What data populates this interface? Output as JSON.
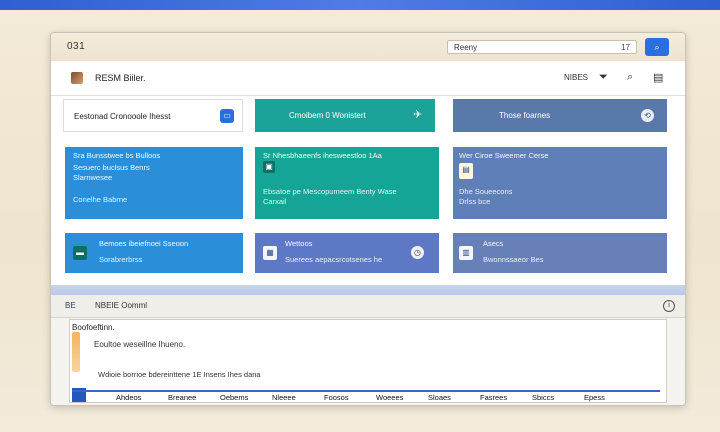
{
  "window": {
    "title": "031"
  },
  "search": {
    "value": "Reeny",
    "filter_label": "17",
    "button_icon": "search-icon"
  },
  "header": {
    "app_name": "RESM Biiler.",
    "user_label": "NIBES",
    "icons": [
      "filter-icon",
      "search-icon",
      "grid-icon"
    ]
  },
  "tiles_top": [
    {
      "label": "Eestonad Cronooole Ihesst",
      "color": "#ffffff"
    },
    {
      "label": "Cmoibem 0 Wonistert",
      "color": "#1ba39a"
    },
    {
      "label": "Those foarnes",
      "color": "#5a79ab"
    }
  ],
  "tiles_mid": [
    {
      "lines": [
        "Sra Bunsstwee bs Bulloos",
        "Sesuerc buclsus Benrs",
        "Slarnwesee"
      ],
      "sub": "Conelhe Babrne",
      "color": "#2a8fd8"
    },
    {
      "lines": [
        "Sr Nhesbhaeenfs ihesweestloo 1Aa"
      ],
      "sub": "Ebsatoe pe Mescopumeem Benty Wase",
      "sub2": "Carxail",
      "color": "#15a596"
    },
    {
      "lines": [
        "Wer Ciroe Sweemer Cerse"
      ],
      "sub": "Dhe Soueecons",
      "sub2": "Drlss bce",
      "color": "#5e7fb7"
    }
  ],
  "tiles_low": [
    {
      "title": "Bemoes ibeiefnoei Sseoon",
      "sub": "Sorabrerbrss",
      "color": "#2a8fd8"
    },
    {
      "title": "Wettoos",
      "sub": "Suerees aepacsrcotsenes he",
      "color": "#5d79c6"
    },
    {
      "title": "Asecs",
      "sub": "Bwonnssaeor Bes",
      "color": "#6780b8"
    }
  ],
  "bottom": {
    "tag": "BE",
    "label": "NBEIE Oomml",
    "line1": "Boofoeftinn.",
    "line2": "Eoultoe weseillne Ihueno.",
    "line3": "Wdioie borrioe bdereinttene 1E Insens Ihes dana",
    "columns": [
      "Ahdeos",
      "Breanee",
      "Oebems",
      "Nleeee",
      "Foosos",
      "Woeees",
      "Sloaes",
      "Fasrees",
      "Sbiccs",
      "Epess"
    ]
  }
}
